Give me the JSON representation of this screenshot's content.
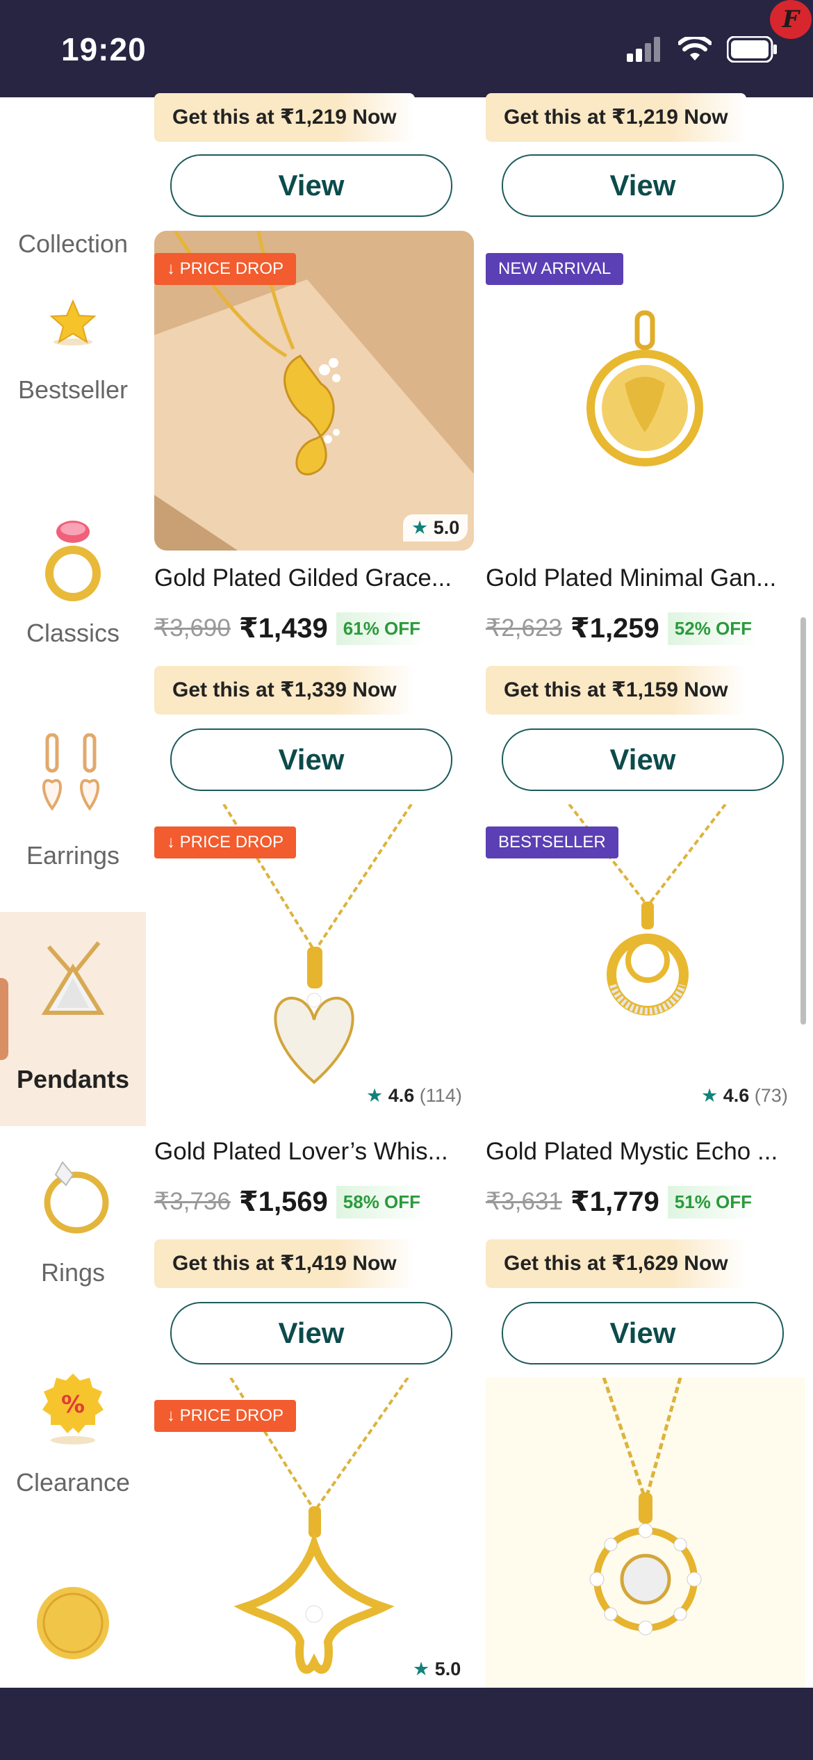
{
  "status": {
    "time": "19:20"
  },
  "sidebar": {
    "items": [
      {
        "label": "Collection"
      },
      {
        "label": "Bestseller"
      },
      {
        "label": "Classics"
      },
      {
        "label": "Earrings"
      },
      {
        "label": "Pendants"
      },
      {
        "label": "Rings"
      },
      {
        "label": "Clearance"
      }
    ]
  },
  "top": {
    "left_getnow": "Get this at ₹1,219 Now",
    "right_getnow": "Get this at ₹1,219 Now",
    "view": "View"
  },
  "products": [
    {
      "tag": "PRICE DROP",
      "rating": "5.0",
      "count": "",
      "name": "Gold Plated Gilded Grace...",
      "mrp": "₹3,690",
      "price": "₹1,439",
      "off": "61% OFF",
      "getnow": "Get this at ₹1,339 Now",
      "view": "View"
    },
    {
      "tag": "NEW ARRIVAL",
      "rating": "",
      "count": "",
      "name": "Gold Plated Minimal Gan...",
      "mrp": "₹2,623",
      "price": "₹1,259",
      "off": "52% OFF",
      "getnow": "Get this at ₹1,159 Now",
      "view": "View"
    },
    {
      "tag": "PRICE DROP",
      "rating": "4.6",
      "count": "(114)",
      "name": "Gold Plated Lover’s Whis...",
      "mrp": "₹3,736",
      "price": "₹1,569",
      "off": "58% OFF",
      "getnow": "Get this at ₹1,419 Now",
      "view": "View"
    },
    {
      "tag": "BESTSELLER",
      "rating": "4.6",
      "count": "(73)",
      "name": "Gold Plated Mystic Echo ...",
      "mrp": "₹3,631",
      "price": "₹1,779",
      "off": "51% OFF",
      "getnow": "Get this at ₹1,629 Now",
      "view": "View"
    },
    {
      "tag": "PRICE DROP",
      "rating": "5.0",
      "count": ""
    },
    {
      "tag": "",
      "rating": "",
      "count": ""
    }
  ],
  "colors": {
    "header": "#272542",
    "accent": "#0d4b4b",
    "price_drop": "#f25c2e",
    "purple_tag": "#5b3fb4",
    "active_side": "#f9ebdd"
  }
}
